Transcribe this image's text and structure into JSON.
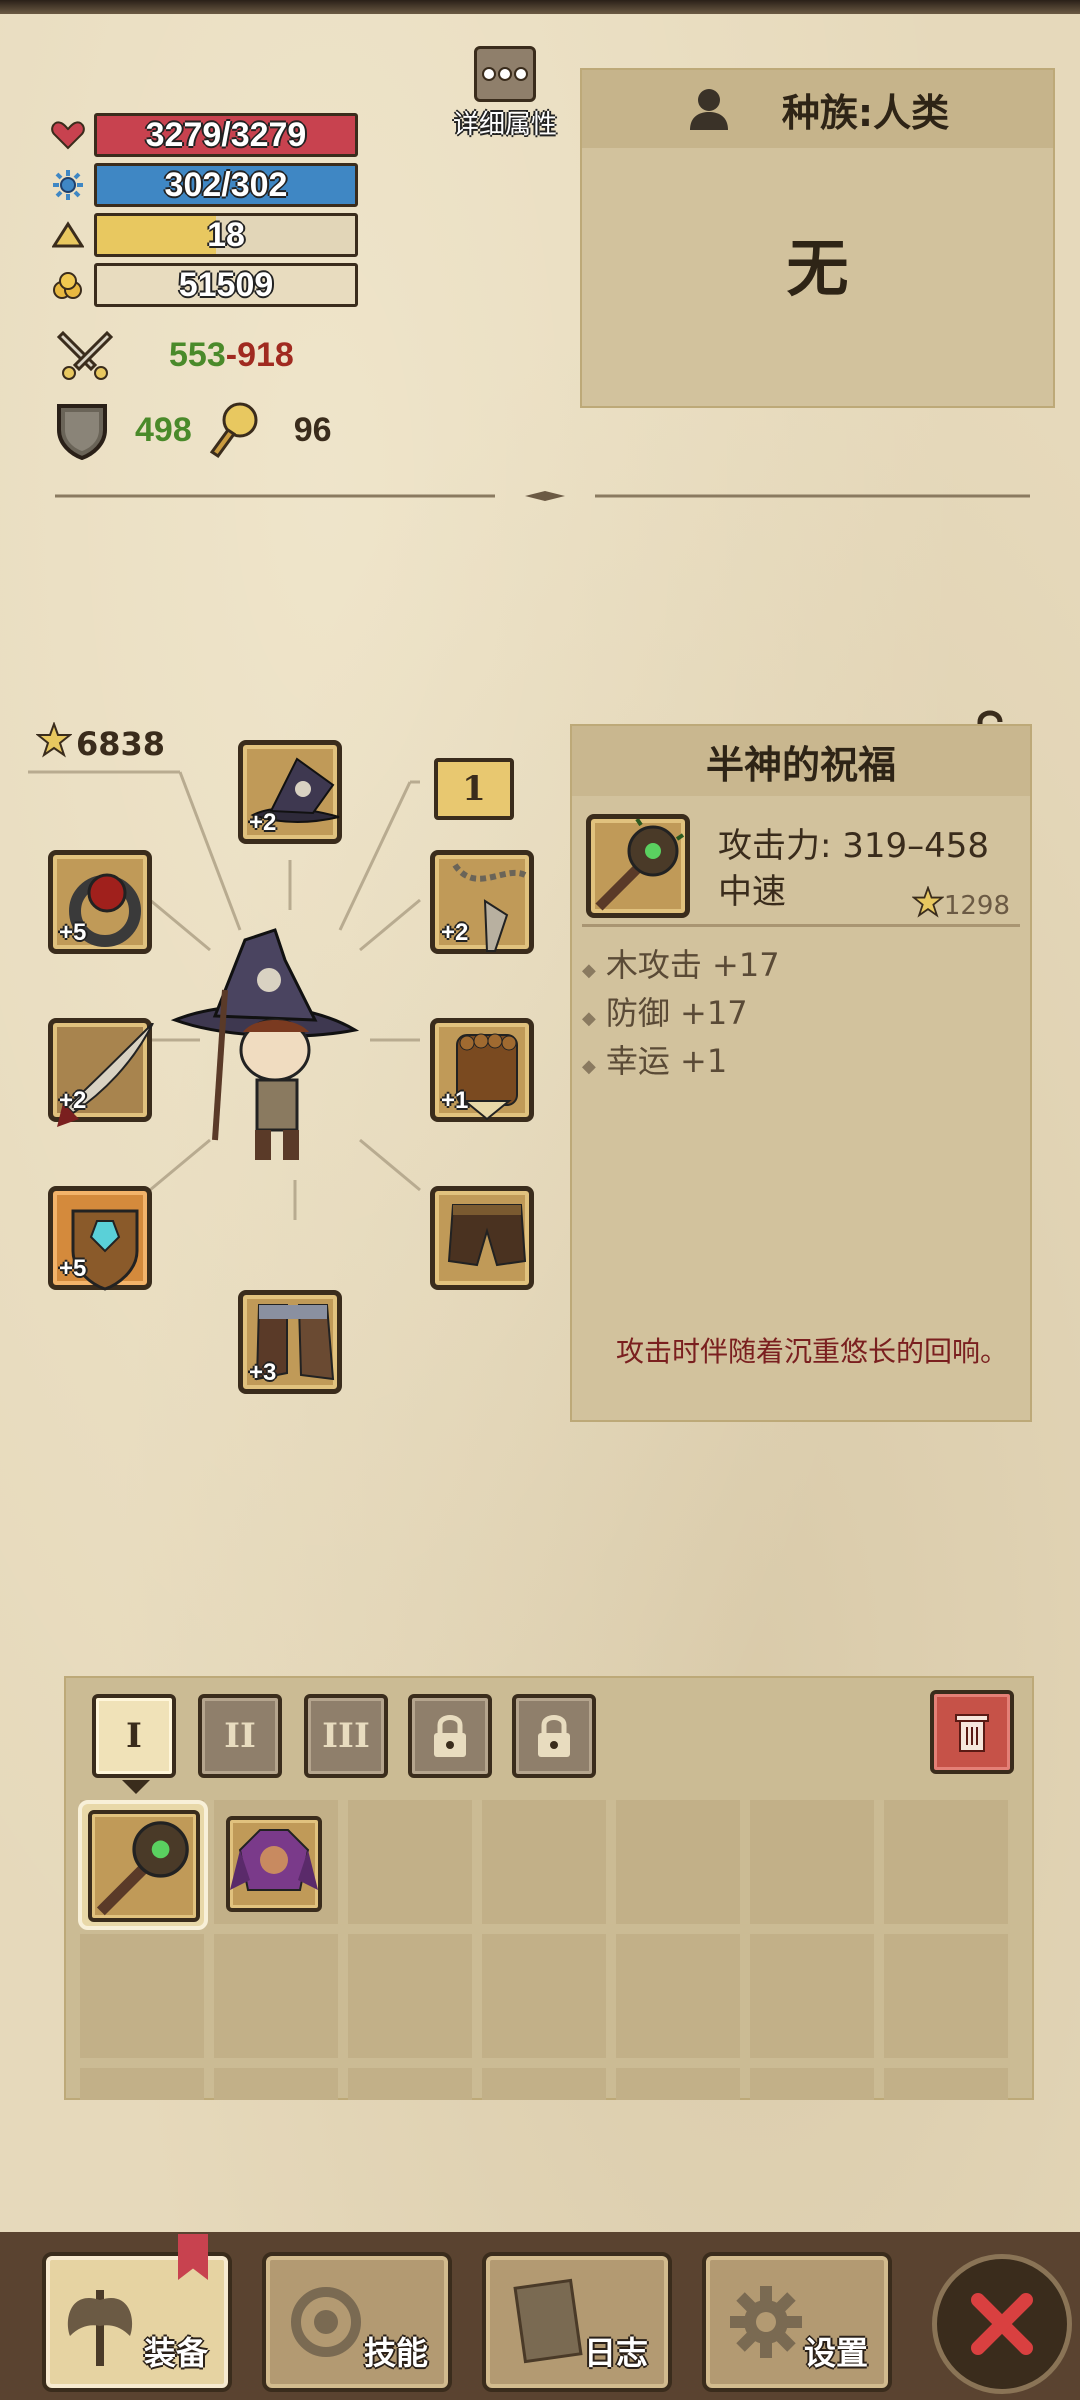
{
  "stats": {
    "hp": "3279/3279",
    "mp": "302/302",
    "level": "18",
    "gold": "51509",
    "damage_min": "553",
    "damage_sep": "-",
    "damage_max": "918",
    "defense": "498",
    "luck": "96"
  },
  "detail_button": {
    "label": "详细属性"
  },
  "race_panel": {
    "title": "种族:人类",
    "value": "无"
  },
  "equipment": {
    "power": "6838",
    "tier": "1",
    "slots": {
      "hat_level": "+2",
      "ring_level": "+5",
      "amulet_level": "+2",
      "weapon_level": "+2",
      "bracer_level": "+1",
      "shield_level": "+5",
      "pants_level": "",
      "boots_level": "+3"
    }
  },
  "item_detail": {
    "title": "半神的祝福",
    "attack": "攻击力: 319–458",
    "speed": "中速",
    "score": "1298",
    "stats": [
      "木攻击 +17",
      "防御 +17",
      "幸运 +1"
    ],
    "description": "攻击时伴随着沉重悠长的回响。"
  },
  "inventory": {
    "tabs": [
      "I",
      "II",
      "III"
    ]
  },
  "nav": {
    "equip": "装备",
    "skills": "技能",
    "log": "日志",
    "settings": "设置"
  },
  "colors": {
    "hp": "#c8424f",
    "mp": "#3f87c4",
    "xp": "#e8c860",
    "dmg_min": "#4a8a2a",
    "dmg_max": "#a02a20"
  }
}
